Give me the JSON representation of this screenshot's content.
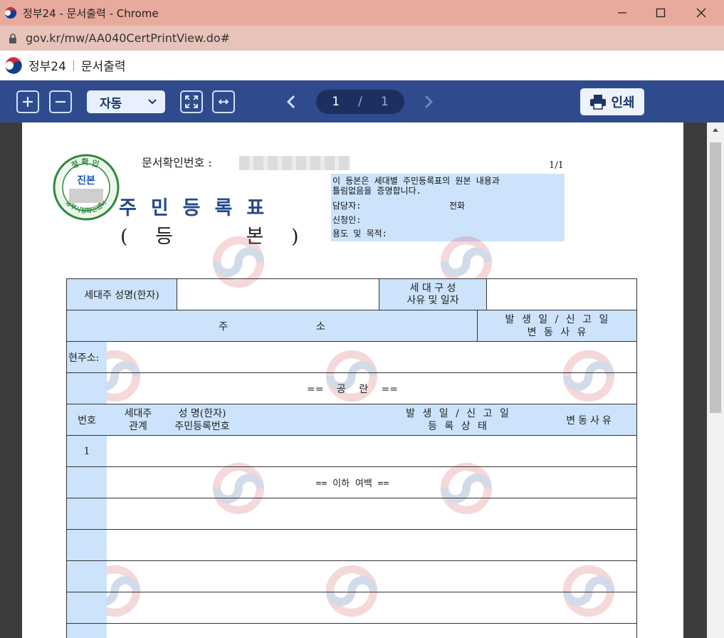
{
  "window": {
    "title": "정부24 - 문서출력 - Chrome",
    "url": "gov.kr/mw/AA040CertPrintView.do#"
  },
  "site": {
    "name": "정부24",
    "page": "문서출력"
  },
  "toolbar": {
    "zoom_value": "자동",
    "current_page": "1",
    "separator": "/",
    "total_pages": "1",
    "print_label": "인쇄"
  },
  "document": {
    "doc_id_label": "문서확인번호 :",
    "page_indicator": "1/1",
    "title": "주민등록표",
    "subtitle_open": "(",
    "subtitle_a": "등",
    "subtitle_b": "본",
    "subtitle_close": ")",
    "seal_top": "정확인",
    "seal_center": "진본",
    "seal_bottom": "동부시정확인센터",
    "cert": {
      "line1": "이 등본은 세대별 주민등록표의 원본 내용과",
      "line2": "틀림없음을 증명합니다.",
      "manager_label": "담당자:",
      "phone_label": "전화",
      "applicant_label": "신청인:",
      "purpose_label": "용도 및 목적:"
    },
    "table": {
      "head_name": "세대주 성명(한자)",
      "comp_line1": "세 대 구 성",
      "comp_line2": "사유 및 일자",
      "addr_header_a": "주",
      "addr_header_b": "소",
      "date_line1": "발 생 일 / 신 고 일",
      "date_line2": "변 동 사 유",
      "current_addr": "현주소:",
      "blank": "== 공 란 ==",
      "col_no": "번호",
      "col_rel1": "세대주",
      "col_rel2": "관계",
      "col_name1": "성 명(한자)",
      "col_name2": "주민등록번호",
      "col_date1": "발 생 일 / 신 고 일",
      "col_date2": "등 록 상 태",
      "col_reason": "변동사유",
      "row1_no": "1",
      "end": "== 이하 여백 =="
    }
  }
}
